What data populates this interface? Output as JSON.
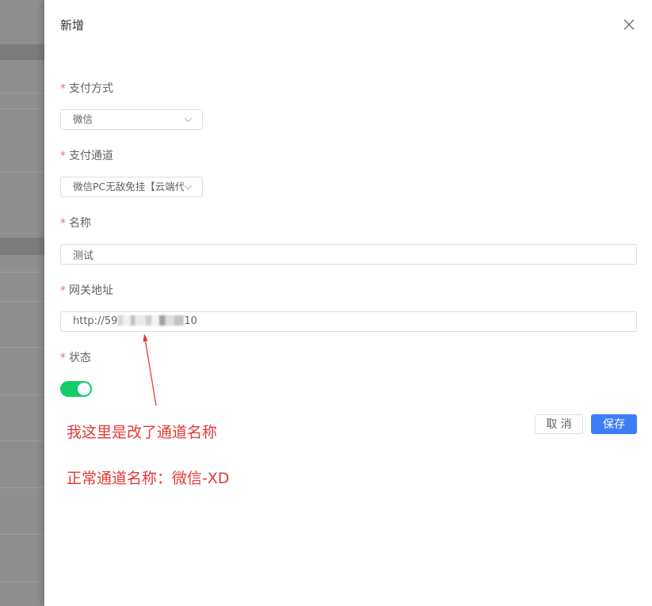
{
  "drawer": {
    "title": "新增"
  },
  "form": {
    "required_mark": "*",
    "payment_method": {
      "label": "支付方式",
      "value": "微信"
    },
    "payment_channel": {
      "label": "支付通道",
      "value": "微信PC无敌免挂【云端代"
    },
    "name": {
      "label": "名称",
      "value": "测试"
    },
    "gateway": {
      "label": "网关地址",
      "value_prefix": "http://59",
      "value_suffix": "10"
    },
    "status": {
      "label": "状态",
      "on": true
    }
  },
  "actions": {
    "cancel_label": "取 消",
    "save_label": "保存"
  },
  "annotation": {
    "line1": "我这里是改了通道名称",
    "line2": "正常通道名称：微信-XD"
  },
  "icons": {
    "close": "close-icon",
    "select_arrow": "chevron-down-icon",
    "pointer": "arrow-icon"
  },
  "colors": {
    "primary": "#3d7ef7",
    "switch_on": "#13ce66",
    "required": "#f56c6c",
    "annotation": "#e53935"
  }
}
